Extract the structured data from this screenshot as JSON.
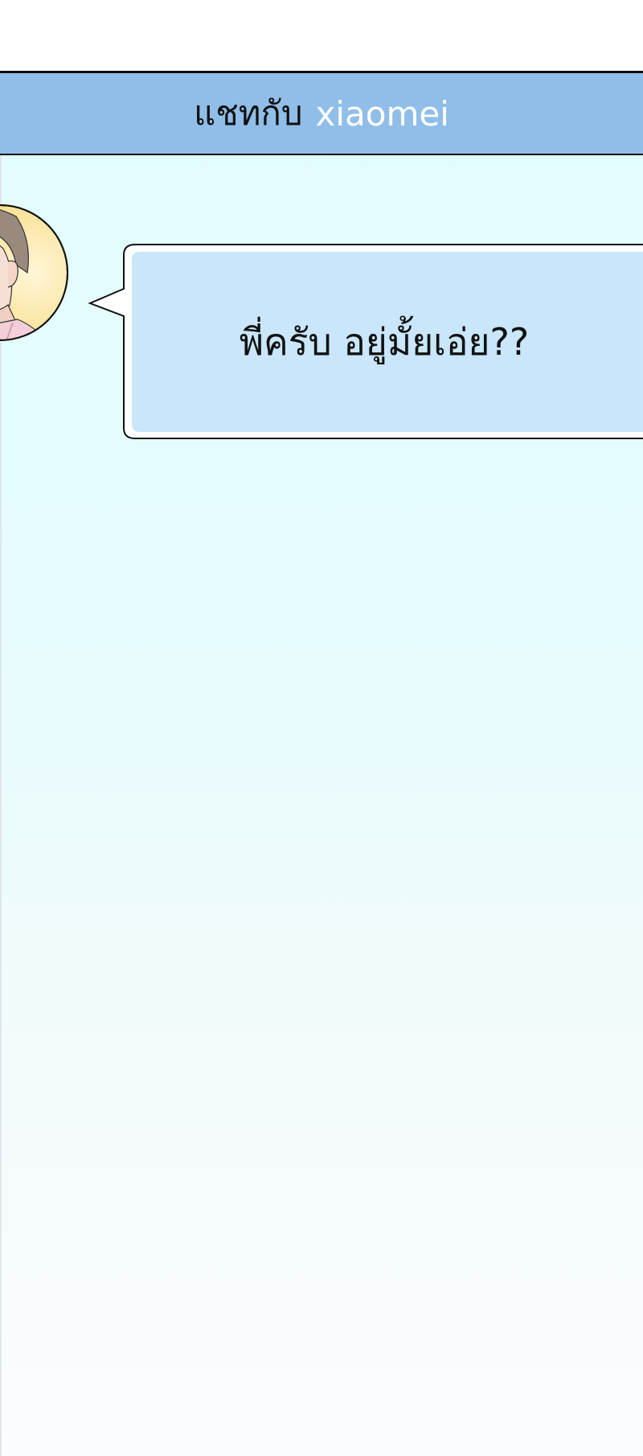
{
  "chat": {
    "header": {
      "prefix": "แชทกับ",
      "contact_name": "xiaomei"
    },
    "messages": [
      {
        "text": "พี่ครับ อยู่มั้ยเอ่ย??"
      }
    ]
  },
  "colors": {
    "header_bg": "#90bee8",
    "bubble_bg": "#c9e6fb",
    "chat_bg_top": "#e2fdff",
    "chat_bg_bottom": "#fbfcfd"
  },
  "icons": {
    "avatar": "contact-avatar-portrait"
  }
}
